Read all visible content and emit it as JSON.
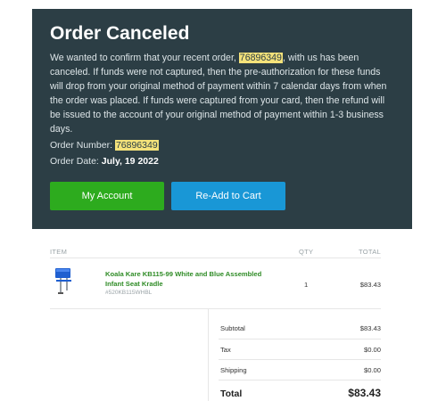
{
  "hero": {
    "title": "Order Canceled",
    "body_pre": "We wanted to confirm that your recent order, ",
    "body_order": "76896349",
    "body_post": ", with us has been canceled. If funds were not captured, then the pre-authorization for these funds will drop from your original method of payment within 7 calendar days from when the order was placed. If funds were captured from your card, then the refund will be issued to the account of your original method of payment within 1-3 business days.",
    "order_number_label": "Order Number: ",
    "order_number": "76896349",
    "order_date_label": "Order Date: ",
    "order_date": "July, 19 2022",
    "my_account_label": "My Account",
    "readd_label": "Re-Add to Cart"
  },
  "table": {
    "col_item": "ITEM",
    "col_qty": "QTY",
    "col_total": "TOTAL",
    "item": {
      "name": "Koala Kare KB115-99 White and Blue Assembled Infant Seat Kradle",
      "sku": "#520KB115WHBL",
      "qty": "1",
      "total": "$83.43"
    }
  },
  "summary": {
    "subtotal_label": "Subtotal",
    "subtotal": "$83.43",
    "tax_label": "Tax",
    "tax": "$0.00",
    "shipping_label": "Shipping",
    "shipping": "$0.00",
    "total_label": "Total",
    "total": "$83.43"
  },
  "colors": {
    "hero_bg": "#2c3e45",
    "highlight": "#f4e27a",
    "green": "#2dab1e",
    "blue": "#1997d6"
  }
}
